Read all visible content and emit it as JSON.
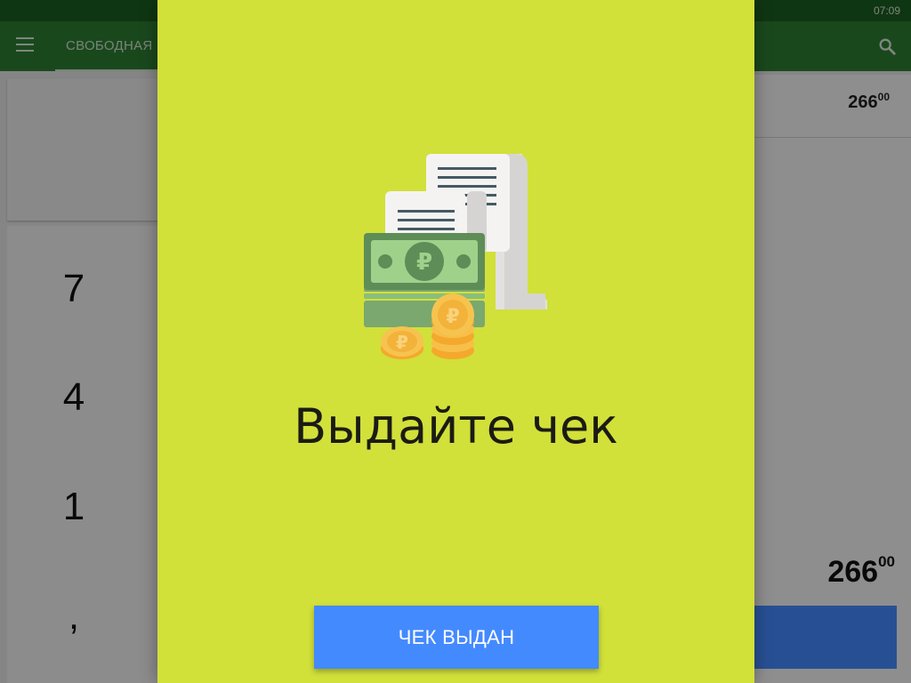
{
  "status_bar": {
    "time": "07:09"
  },
  "app_bar": {
    "tab_label": "СВОБОДНАЯ ПРОДАЖА"
  },
  "keypad": {
    "keys": [
      "7",
      "4",
      "1",
      ","
    ]
  },
  "receipt": {
    "line_amount_main": "266",
    "line_amount_cents": "00",
    "total_main": "266",
    "total_cents": "00"
  },
  "dialog": {
    "title": "Выдайте чек",
    "confirm_label": "ЧЕК ВЫДАН",
    "illustration_icon": "receipt-money-icon",
    "currency_symbol": "₽"
  },
  "colors": {
    "status_bar": "#1b5e20",
    "app_bar": "#2e7d32",
    "dialog_bg": "#d2e03a",
    "button": "#448aff"
  }
}
